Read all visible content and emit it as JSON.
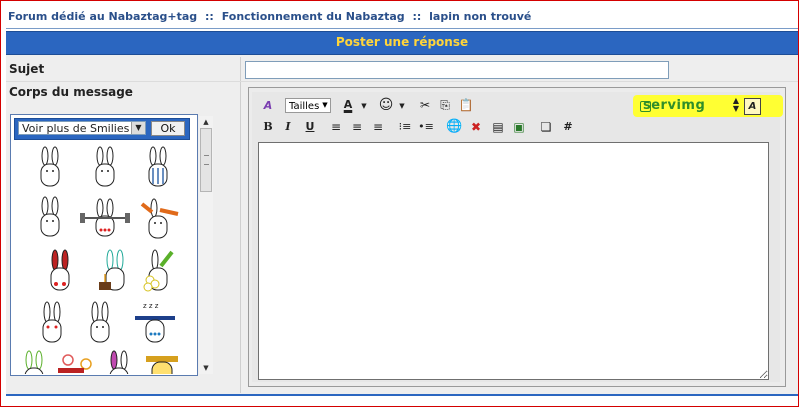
{
  "breadcrumb": {
    "forum": "Forum dédié au Nabaztag+tag",
    "sep1": "::",
    "category": "Fonctionnement du Nabaztag",
    "sep2": "::",
    "topic": "lapin non trouvé"
  },
  "header": {
    "title": "Poster une réponse"
  },
  "form": {
    "subject_label": "Sujet",
    "subject_value": "",
    "body_label": "Corps du message"
  },
  "smilies": {
    "select_value": "Voir plus de Smilies",
    "ok_label": "Ok",
    "icons": [
      "bunny-icon",
      "bunny-icon",
      "bunny-icon",
      "bunny-icon",
      "bunny-icon",
      "bunny-icon",
      "bunny-icon",
      "bunny-icon",
      "bunny-icon",
      "bunny-icon",
      "bunny-icon",
      "bunny-icon"
    ]
  },
  "editor": {
    "size_select": "Tailles",
    "servimg_label": "servimg",
    "bold": "B",
    "italic": "I",
    "underline": "U",
    "hash": "#",
    "text_value": ""
  },
  "colors": {
    "header_bg": "#2b66c0",
    "header_text": "#ffd53a",
    "breadcrumb_text": "#2a4f8a",
    "highlight": "#ffff33"
  }
}
